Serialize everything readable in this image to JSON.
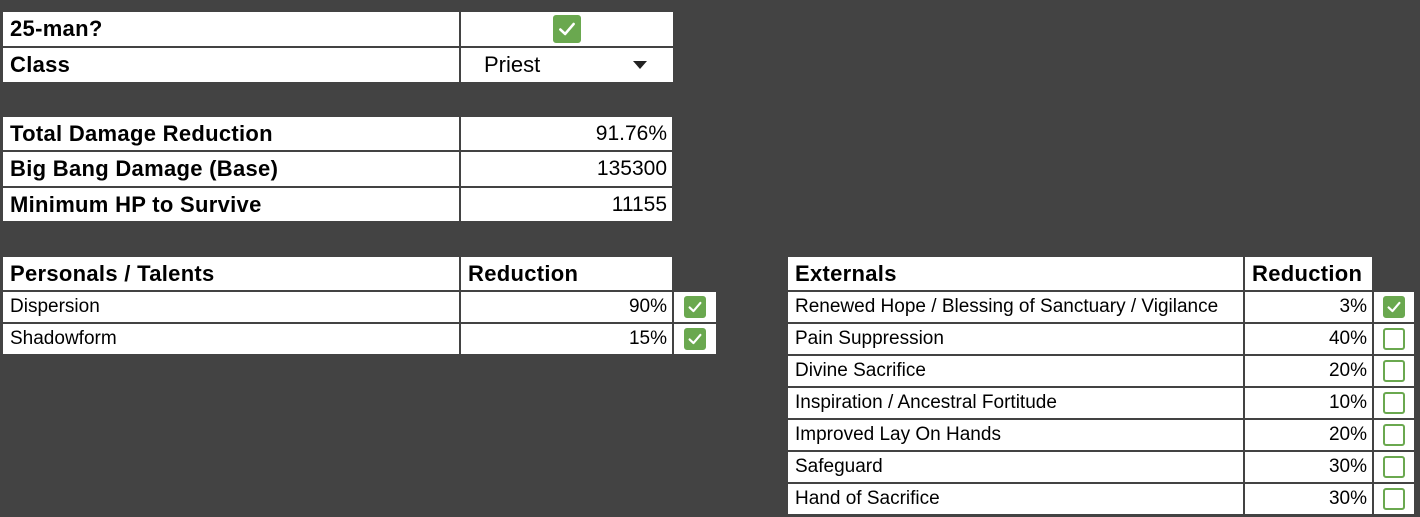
{
  "settings": {
    "raid_size_label": "25-man?",
    "raid_size_checked": true,
    "class_label": "Class",
    "class_value": "Priest"
  },
  "summary": {
    "total_dr_label": "Total Damage Reduction",
    "total_dr_value": "91.76%",
    "big_bang_label": "Big Bang Damage (Base)",
    "big_bang_value": "135300",
    "min_hp_label": "Minimum HP to Survive",
    "min_hp_value": "11155"
  },
  "personals": {
    "header_name": "Personals / Talents",
    "header_reduction": "Reduction",
    "rows": [
      {
        "name": "Dispersion",
        "reduction": "90%",
        "checked": true
      },
      {
        "name": "Shadowform",
        "reduction": "15%",
        "checked": true
      }
    ]
  },
  "externals": {
    "header_name": "Externals",
    "header_reduction": "Reduction",
    "rows": [
      {
        "name": "Renewed Hope / Blessing of Sanctuary / Vigilance",
        "reduction": "3%",
        "checked": true
      },
      {
        "name": "Pain Suppression",
        "reduction": "40%",
        "checked": false
      },
      {
        "name": "Divine Sacrifice",
        "reduction": "20%",
        "checked": false
      },
      {
        "name": "Inspiration / Ancestral Fortitude",
        "reduction": "10%",
        "checked": false
      },
      {
        "name": "Improved Lay On Hands",
        "reduction": "20%",
        "checked": false
      },
      {
        "name": "Safeguard",
        "reduction": "30%",
        "checked": false
      },
      {
        "name": "Hand of Sacrifice",
        "reduction": "30%",
        "checked": false
      }
    ]
  },
  "icons": {
    "checkbox": "checkbox-icon",
    "dropdown": "dropdown-arrow-icon"
  },
  "colors": {
    "background": "#434343",
    "checkbox_green": "#6aa84f"
  }
}
